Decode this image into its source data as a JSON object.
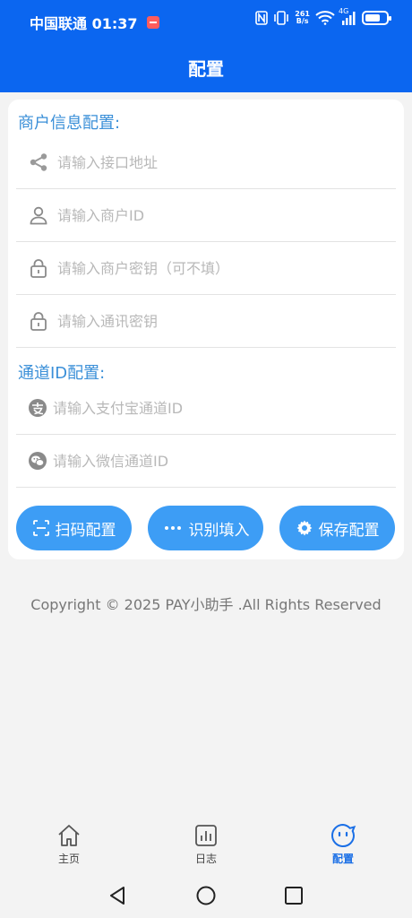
{
  "status_bar": {
    "carrier_time": "中国联通 01:37",
    "net_speed_value": "261",
    "net_speed_unit": "B/s",
    "signal_label": "4G"
  },
  "header": {
    "title": "配置"
  },
  "merchant_section": {
    "title": "商户信息配置:",
    "fields": [
      {
        "icon": "share-icon",
        "placeholder": "请输入接口地址",
        "value": ""
      },
      {
        "icon": "user-icon",
        "placeholder": "请输入商户ID",
        "value": ""
      },
      {
        "icon": "lock-icon",
        "placeholder": "请输入商户密钥（可不填）",
        "value": ""
      },
      {
        "icon": "lock-icon",
        "placeholder": "请输入通讯密钥",
        "value": ""
      }
    ]
  },
  "channel_section": {
    "title": "通道ID配置:",
    "fields": [
      {
        "icon": "alipay-icon",
        "placeholder": "请输入支付宝通道ID",
        "value": ""
      },
      {
        "icon": "wechat-icon",
        "placeholder": "请输入微信通道ID",
        "value": ""
      }
    ]
  },
  "actions": {
    "scan": "扫码配置",
    "recognize": "识别填入",
    "save": "保存配置"
  },
  "copyright": "Copyright © 2025 PAY小助手 .All Rights Reserved",
  "bottom_nav": {
    "items": [
      {
        "label": "主页",
        "icon": "home-icon",
        "active": false
      },
      {
        "label": "日志",
        "icon": "chart-icon",
        "active": false
      },
      {
        "label": "配置",
        "icon": "smiley-icon",
        "active": true
      }
    ]
  },
  "colors": {
    "header_bg": "#0b66f0",
    "accent": "#3d9df5",
    "section_title": "#3a8fd8",
    "nav_active": "#1a6fe6"
  }
}
